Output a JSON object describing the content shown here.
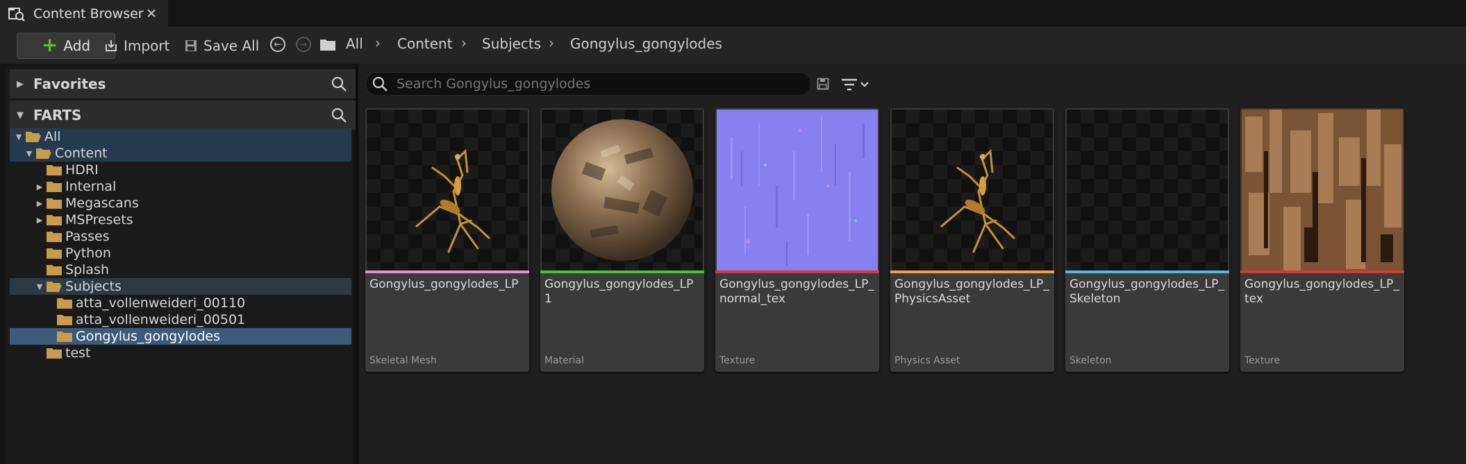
{
  "tab": {
    "title": "Content Browser",
    "close": "✕"
  },
  "toolbar": {
    "add_label": "Add",
    "import_label": "Import",
    "save_all_label": "Save All",
    "breadcrumb": [
      "All",
      "Content",
      "Subjects",
      "Gongylus_gongylodes"
    ]
  },
  "sidebar": {
    "favorites_label": "Favorites",
    "project_label": "FARTS",
    "tree": [
      {
        "label": "All",
        "depth": 0,
        "expanded": true
      },
      {
        "label": "Content",
        "depth": 1,
        "expanded": true
      },
      {
        "label": "HDRI",
        "depth": 2
      },
      {
        "label": "Internal",
        "depth": 2,
        "collapsed": true
      },
      {
        "label": "Megascans",
        "depth": 2,
        "collapsed": true
      },
      {
        "label": "MSPresets",
        "depth": 2,
        "collapsed": true
      },
      {
        "label": "Passes",
        "depth": 2
      },
      {
        "label": "Python",
        "depth": 2
      },
      {
        "label": "Splash",
        "depth": 2
      },
      {
        "label": "Subjects",
        "depth": 2,
        "expanded": true
      },
      {
        "label": "atta_vollenweideri_00110",
        "depth": 3
      },
      {
        "label": "atta_vollenweideri_00501",
        "depth": 3
      },
      {
        "label": "Gongylus_gongylodes",
        "depth": 3,
        "selected": true
      },
      {
        "label": "test",
        "depth": 2
      }
    ]
  },
  "search": {
    "placeholder": "Search Gongylus_gongylodes"
  },
  "assets": [
    {
      "name": "Gongylus_gongylodes_LP",
      "type": "Skeletal Mesh",
      "color": "#e58fd8",
      "thumb": "mantis"
    },
    {
      "name": "Gongylus_gongylodes_LP1",
      "type": "Material",
      "color": "#4cc23f",
      "thumb": "sphere"
    },
    {
      "name": "Gongylus_gongylodes_LP_normal_tex",
      "type": "Texture",
      "color": "#d23a3a",
      "thumb": "normal"
    },
    {
      "name": "Gongylus_gongylodes_LP_PhysicsAsset",
      "type": "Physics Asset",
      "color": "#f0a24a",
      "thumb": "mantis"
    },
    {
      "name": "Gongylus_gongylodes_LP_Skeleton",
      "type": "Skeleton",
      "color": "#5ab6dc",
      "thumb": "empty"
    },
    {
      "name": "Gongylus_gongylodes_LP_tex",
      "type": "Texture",
      "color": "#d23a3a",
      "thumb": "bark"
    }
  ],
  "colors": {
    "folder": "#c99b4b",
    "accent_blue": "#3d5a7a"
  }
}
